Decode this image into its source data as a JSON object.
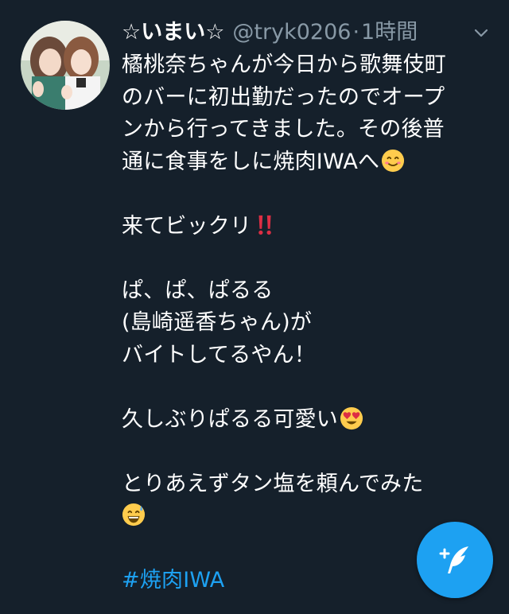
{
  "tweet": {
    "display_name": "☆いまい☆",
    "handle": "@tryk0206",
    "separator": "·",
    "time": "1時間",
    "lines": {
      "l1": "橘桃奈ちゃんが今日から歌舞伎町",
      "l2": "のバーに初出勤だったのでオープ",
      "l3": "ンから行ってきました。その後普",
      "l4": "通に食事をしに焼肉IWAへ",
      "l5": "来てビックリ",
      "l6": "ぱ、ぱ、ぱるる",
      "l7": "(島崎遥香ちゃん)が",
      "l8": "バイトしてるやん！",
      "l9": "久しぶりぱるる可愛い",
      "l10": "とりあえずタン塩を頼んでみた"
    },
    "hashtag": "#焼肉IWA"
  },
  "icons": {
    "avatar": "profile-photo",
    "more": "chevron-down-icon",
    "compose": "compose-tweet-icon",
    "emoji_smile": "smiling-face-emoji",
    "emoji_exclaim": "double-exclamation-emoji",
    "emoji_heart_eyes": "heart-eyes-emoji",
    "emoji_sweat": "grinning-sweat-emoji"
  },
  "colors": {
    "background": "#15202b",
    "text": "#ffffff",
    "secondary_text": "#8899a6",
    "accent": "#1da1f2"
  }
}
